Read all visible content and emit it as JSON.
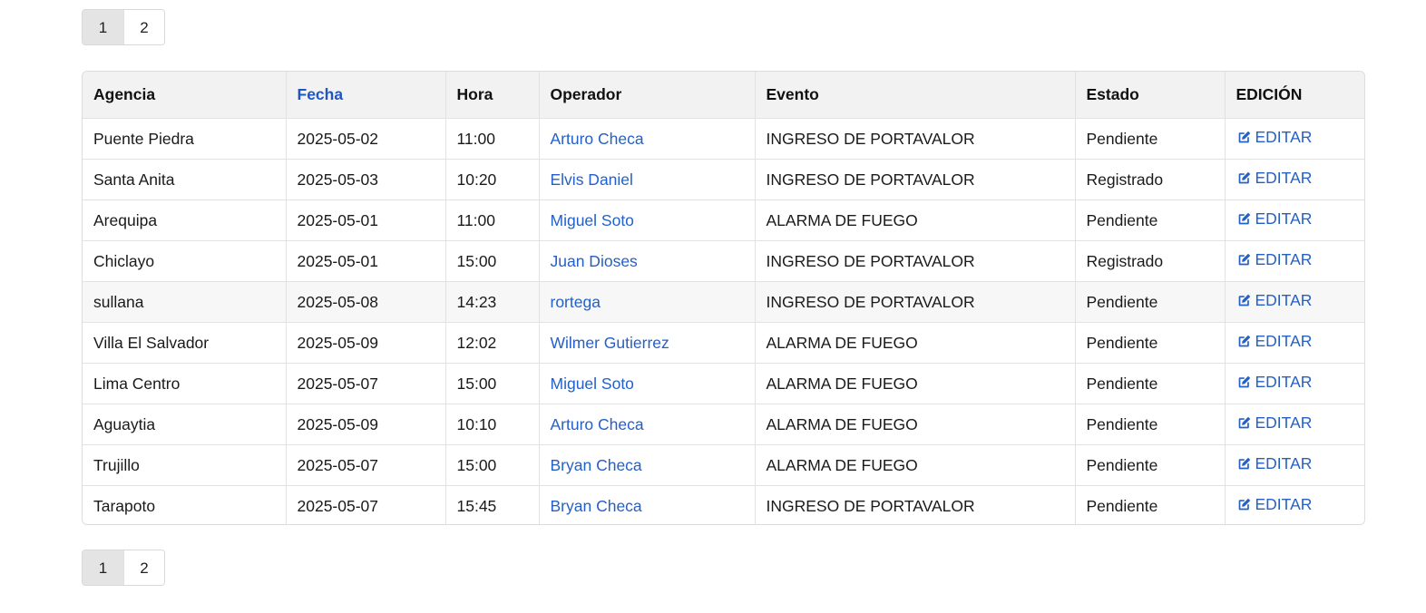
{
  "pagination": {
    "pages": [
      "1",
      "2"
    ],
    "active_page": 1
  },
  "table": {
    "headers": {
      "agencia": "Agencia",
      "fecha": "Fecha",
      "hora": "Hora",
      "operador": "Operador",
      "evento": "Evento",
      "estado": "Estado",
      "edicion": "EDICIÓN"
    },
    "sortable_color": "#1f56c4",
    "link_color": "#2460c6",
    "edit_label": "EDITAR",
    "edit_icon": "edit-square-icon",
    "rows": [
      {
        "agencia": "Puente Piedra",
        "fecha": "2025-05-02",
        "hora": "11:00",
        "operador": "Arturo Checa",
        "evento": "INGRESO DE PORTAVALOR",
        "estado": "Pendiente",
        "edit": "EDITAR"
      },
      {
        "agencia": "Santa Anita",
        "fecha": "2025-05-03",
        "hora": "10:20",
        "operador": "Elvis Daniel",
        "evento": "INGRESO DE PORTAVALOR",
        "estado": "Registrado",
        "edit": "EDITAR"
      },
      {
        "agencia": "Arequipa",
        "fecha": "2025-05-01",
        "hora": "11:00",
        "operador": "Miguel Soto",
        "evento": "ALARMA DE FUEGO",
        "estado": "Pendiente",
        "edit": "EDITAR"
      },
      {
        "agencia": "Chiclayo",
        "fecha": "2025-05-01",
        "hora": "15:00",
        "operador": "Juan Dioses",
        "evento": "INGRESO DE PORTAVALOR",
        "estado": "Registrado",
        "edit": "EDITAR"
      },
      {
        "agencia": "sullana",
        "fecha": "2025-05-08",
        "hora": "14:23",
        "operador": "rortega",
        "evento": "INGRESO DE PORTAVALOR",
        "estado": "Pendiente",
        "edit": "EDITAR"
      },
      {
        "agencia": "Villa El Salvador",
        "fecha": "2025-05-09",
        "hora": "12:02",
        "operador": "Wilmer Gutierrez",
        "evento": "ALARMA DE FUEGO",
        "estado": "Pendiente",
        "edit": "EDITAR"
      },
      {
        "agencia": "Lima Centro",
        "fecha": "2025-05-07",
        "hora": "15:00",
        "operador": "Miguel Soto",
        "evento": "ALARMA DE FUEGO",
        "estado": "Pendiente",
        "edit": "EDITAR"
      },
      {
        "agencia": "Aguaytia",
        "fecha": "2025-05-09",
        "hora": "10:10",
        "operador": "Arturo Checa",
        "evento": "ALARMA DE FUEGO",
        "estado": "Pendiente",
        "edit": "EDITAR"
      },
      {
        "agencia": "Trujillo",
        "fecha": "2025-05-07",
        "hora": "15:00",
        "operador": "Bryan Checa",
        "evento": "ALARMA DE FUEGO",
        "estado": "Pendiente",
        "edit": "EDITAR"
      },
      {
        "agencia": "Tarapoto",
        "fecha": "2025-05-07",
        "hora": "15:45",
        "operador": "Bryan Checa",
        "evento": "INGRESO DE PORTAVALOR",
        "estado": "Pendiente",
        "edit": "EDITAR"
      }
    ]
  }
}
